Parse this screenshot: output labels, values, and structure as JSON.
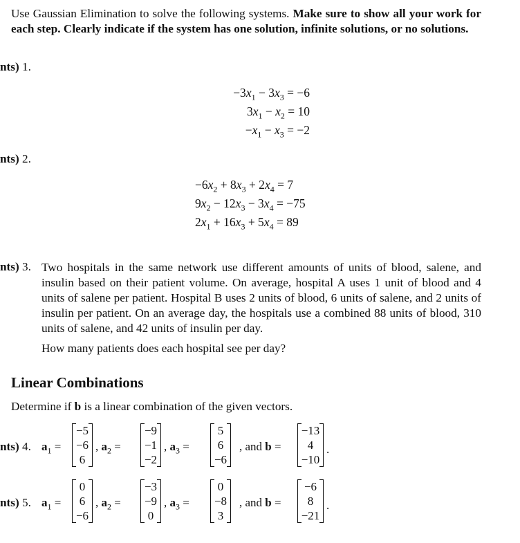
{
  "instructions": {
    "plain": "Use Gaussian Elimination to solve the following systems.",
    "bold": "Make sure to show all your work for each step. Clearly indicate if the system has one solution, infinite solutions, or no solutions."
  },
  "problems": [
    {
      "prefix": "nts)",
      "number": "1.",
      "equations": [
        "−3x₁ − 3x₃ = −6",
        "3x₁ − x₂ = 10",
        "−x₁ − x₃ = −2"
      ]
    },
    {
      "prefix": "nts)",
      "number": "2.",
      "equations": [
        "−6x₂ + 8x₃ + 2x₄ = 7",
        "9x₂ − 12x₃ − 3x₄ = −75",
        "2x₁ + 16x₃ + 5x₄ = 89"
      ]
    },
    {
      "prefix": "nts)",
      "number": "3.",
      "text": "Two hospitals in the same network use different amounts of units of blood, salene, and insulin based on their patient volume. On average, hospital A uses 1 unit of blood and 4 units of salene per patient. Hospital B uses 2 units of blood, 6 units of salene, and 2 units of insulin per patient. On an average day, the hospitals use a combined 88 units of blood, 310 units of salene, and 42 units of insulin per day.",
      "question": "How many patients does each hospital see per day?"
    }
  ],
  "section": {
    "heading": "Linear Combinations",
    "intro_before": "Determine if ",
    "intro_bold": "b",
    "intro_after": " is a linear combination of the given vectors."
  },
  "vector_problems": [
    {
      "prefix": "nts)",
      "number": "4.",
      "a1": [
        "−5",
        "−6",
        "6"
      ],
      "a2": [
        "−9",
        "−1",
        "−2"
      ],
      "a3": [
        "5",
        "6",
        "−6"
      ],
      "b": [
        "−13",
        "4",
        "−10"
      ]
    },
    {
      "prefix": "nts)",
      "number": "5.",
      "a1": [
        "0",
        "6",
        "−6"
      ],
      "a2": [
        "−3",
        "−9",
        "0"
      ],
      "a3": [
        "0",
        "−8",
        "3"
      ],
      "b": [
        "−6",
        "8",
        "−21"
      ]
    }
  ],
  "labels": {
    "a1": "a",
    "a2": "a",
    "a3": "a",
    "sub1": "1",
    "sub2": "2",
    "sub3": "3",
    "b": "b",
    "equals": " =",
    "comma": ",",
    "and": ", and",
    "period": "."
  }
}
